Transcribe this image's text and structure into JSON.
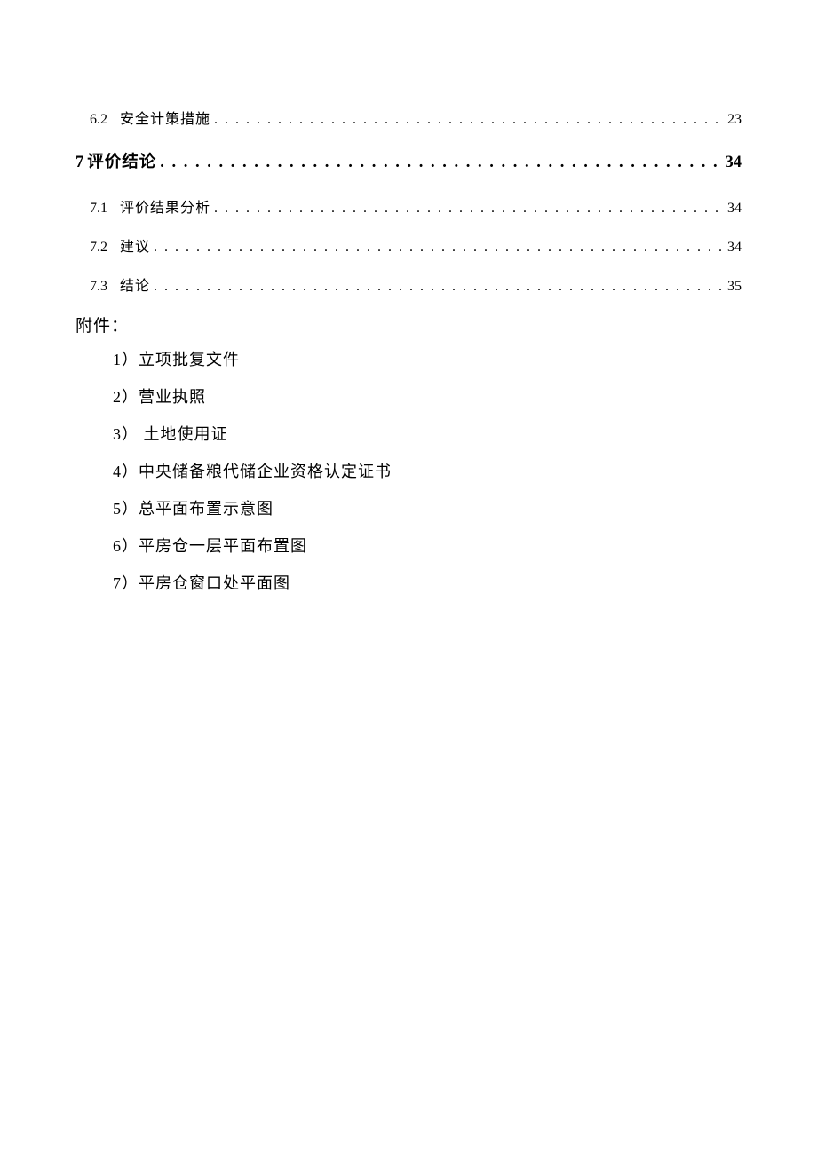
{
  "toc": [
    {
      "level": "sub",
      "num": "6.2",
      "title": "安全计策措施",
      "page": "23"
    },
    {
      "level": "main",
      "num": "7",
      "title": "评价结论",
      "page": "34"
    },
    {
      "level": "sub",
      "num": "7.1",
      "title": "评价结果分析",
      "page": "34"
    },
    {
      "level": "sub",
      "num": "7.2",
      "title": "建议",
      "page": "34"
    },
    {
      "level": "sub",
      "num": "7.3",
      "title": "结论",
      "page": "35"
    }
  ],
  "attachments_header": "附件：",
  "attachments": [
    {
      "num": "1）",
      "text": "立项批复文件"
    },
    {
      "num": "2）",
      "text": "营业执照"
    },
    {
      "num": "3）",
      "text": " 土地使用证"
    },
    {
      "num": "4）",
      "text": "中央储备粮代储企业资格认定证书"
    },
    {
      "num": "5）",
      "text": "总平面布置示意图"
    },
    {
      "num": "6）",
      "text": "平房仓一层平面布置图"
    },
    {
      "num": "7）",
      "text": "平房仓窗口处平面图"
    }
  ]
}
